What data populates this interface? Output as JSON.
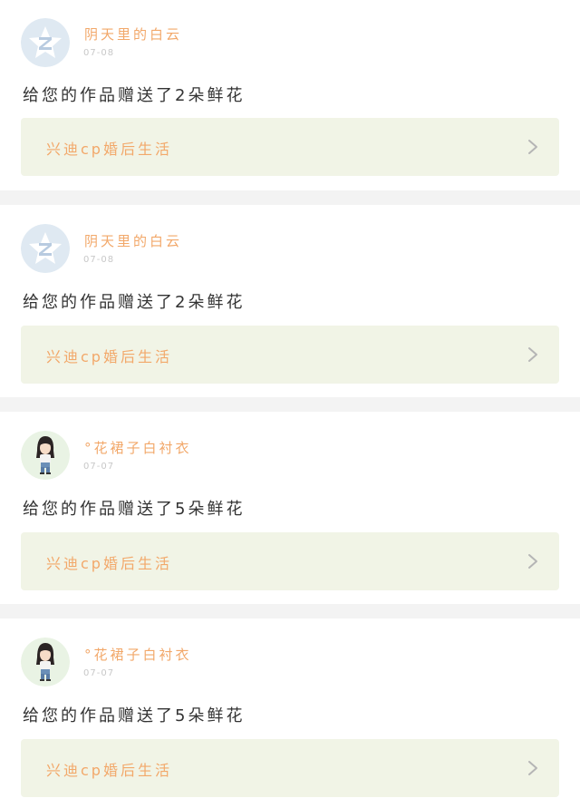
{
  "notifications": [
    {
      "username": "阴天里的白云",
      "time": "07-08",
      "message": "给您的作品赠送了2朵鲜花",
      "work_title": "兴迪cp婚后生活",
      "avatar_icon": "qzone-star-icon"
    },
    {
      "username": "阴天里的白云",
      "time": "07-08",
      "message": "给您的作品赠送了2朵鲜花",
      "work_title": "兴迪cp婚后生活",
      "avatar_icon": "qzone-star-icon"
    },
    {
      "username": "°花裙子白衬衣",
      "time": "07-07",
      "message": "给您的作品赠送了5朵鲜花",
      "work_title": "兴迪cp婚后生活",
      "avatar_icon": "cartoon-girl-avatar"
    },
    {
      "username": "°花裙子白衬衣",
      "time": "07-07",
      "message": "给您的作品赠送了5朵鲜花",
      "work_title": "兴迪cp婚后生活",
      "avatar_icon": "cartoon-girl-avatar"
    }
  ],
  "colors": {
    "accent_orange": "#f2a86a",
    "link_background": "#f1f4e6",
    "page_background": "#f3f3f3",
    "message_text": "#333333",
    "timestamp": "#c8c8c8"
  }
}
